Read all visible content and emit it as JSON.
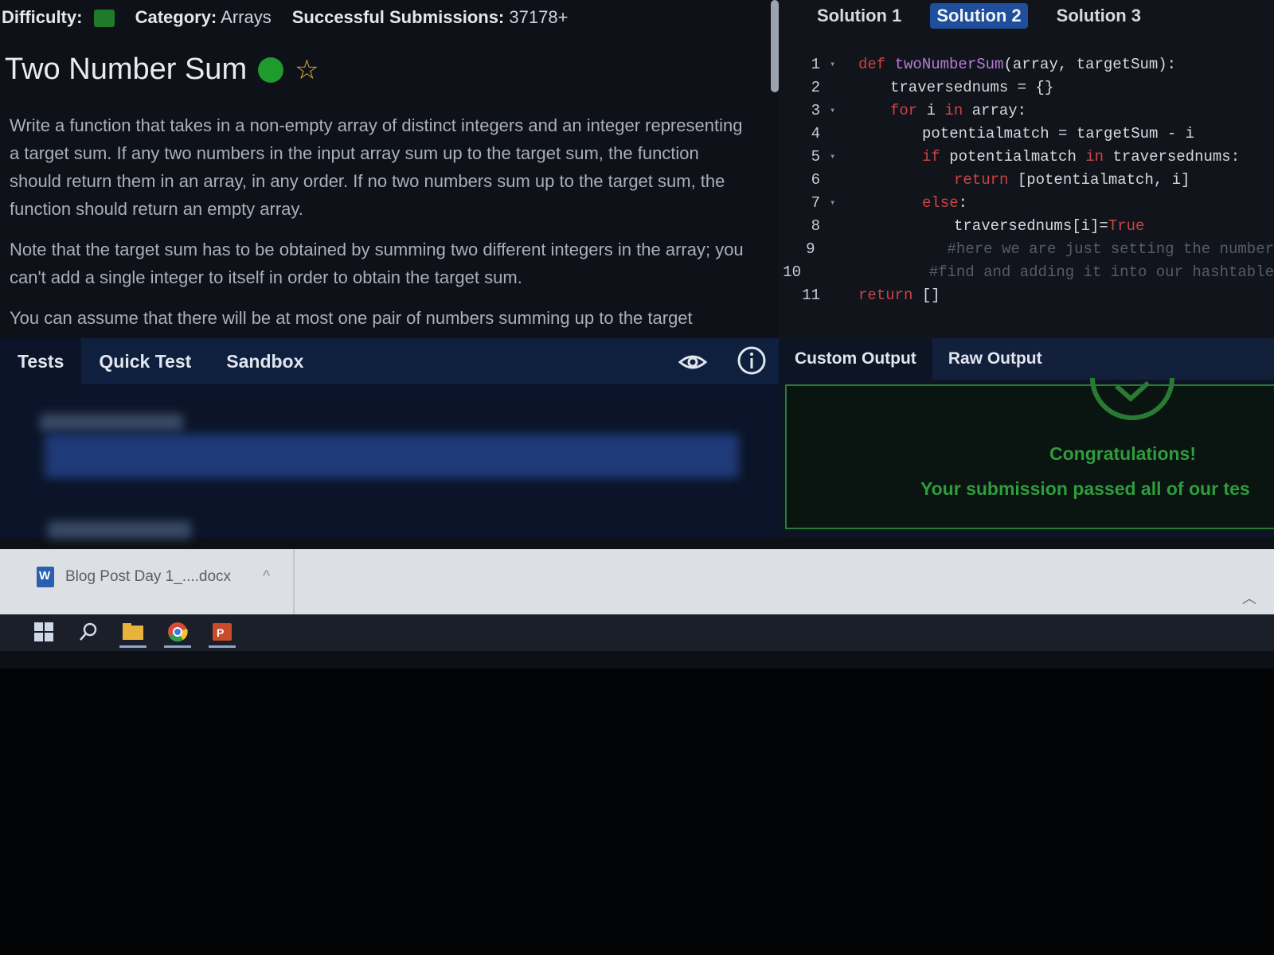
{
  "problem": {
    "difficulty_label": "Difficulty:",
    "category_label": "Category:",
    "category_value": "Arrays",
    "submissions_label": "Successful Submissions:",
    "submissions_value": "37178+",
    "title": "Two Number Sum",
    "paragraphs": [
      "Write a function that takes in a non-empty array of distinct integers and an integer representing a target sum. If any two numbers in the input array sum up to the target sum, the function should return them in an array, in any order. If no two numbers sum up to the target sum, the function should return an empty array.",
      "Note that the target sum has to be obtained by summing two different integers in the array; you can't add a single integer to itself in order to obtain the target sum.",
      "You can assume that there will be at most one pair of numbers summing up to the target"
    ]
  },
  "solution_tabs": [
    "Solution 1",
    "Solution 2",
    "Solution 3"
  ],
  "active_solution": "Solution 2",
  "code_lines": [
    {
      "n": "1",
      "fold": "▾",
      "indent": 0,
      "parts": [
        [
          "kw",
          "def "
        ],
        [
          "fn",
          "twoNumberSum"
        ],
        [
          "",
          "(array, targetSum):"
        ]
      ]
    },
    {
      "n": "2",
      "fold": "",
      "indent": 1,
      "parts": [
        [
          "",
          "traversednums = {}"
        ]
      ]
    },
    {
      "n": "3",
      "fold": "▾",
      "indent": 1,
      "parts": [
        [
          "kw",
          "for "
        ],
        [
          "",
          "i "
        ],
        [
          "kw",
          "in "
        ],
        [
          "",
          "array:"
        ]
      ]
    },
    {
      "n": "4",
      "fold": "",
      "indent": 2,
      "parts": [
        [
          "",
          "potentialmatch = targetSum - i"
        ]
      ]
    },
    {
      "n": "5",
      "fold": "▾",
      "indent": 2,
      "parts": [
        [
          "kw",
          "if "
        ],
        [
          "",
          "potentialmatch "
        ],
        [
          "kw",
          "in "
        ],
        [
          "",
          "traversednums:"
        ]
      ]
    },
    {
      "n": "6",
      "fold": "",
      "indent": 3,
      "parts": [
        [
          "kw",
          "return "
        ],
        [
          "",
          "[potentialmatch, i]"
        ]
      ]
    },
    {
      "n": "7",
      "fold": "▾",
      "indent": 2,
      "parts": [
        [
          "kw",
          "else"
        ],
        [
          "",
          ":"
        ]
      ]
    },
    {
      "n": "8",
      "fold": "",
      "indent": 3,
      "parts": [
        [
          "",
          "traversednums[i]="
        ],
        [
          "kw",
          "True"
        ]
      ]
    },
    {
      "n": "9",
      "fold": "",
      "indent": 3,
      "parts": [
        [
          "cm",
          "#here we are just setting the number"
        ]
      ]
    },
    {
      "n": "10",
      "fold": "",
      "indent": 3,
      "parts": [
        [
          "cm",
          "#find and adding it into our hashtable"
        ]
      ]
    },
    {
      "n": "11",
      "fold": "",
      "indent": 0,
      "parts": [
        [
          "kw",
          "return "
        ],
        [
          "",
          "[]"
        ]
      ]
    }
  ],
  "bottom_tabs": [
    "Tests",
    "Quick Test",
    "Sandbox"
  ],
  "output_tabs": [
    "Custom Output",
    "Raw Output"
  ],
  "success": {
    "heading": "Congratulations!",
    "message": "Your submission passed all of our tes"
  },
  "download": {
    "filename": "Blog Post Day 1_....docx",
    "chevron": "^"
  },
  "icons": {
    "difficulty_color": "#1f7a2a",
    "status_dot_color": "#1f9b2e",
    "accent_tab": "#1f4f9c",
    "success_color": "#2f9c3d"
  }
}
